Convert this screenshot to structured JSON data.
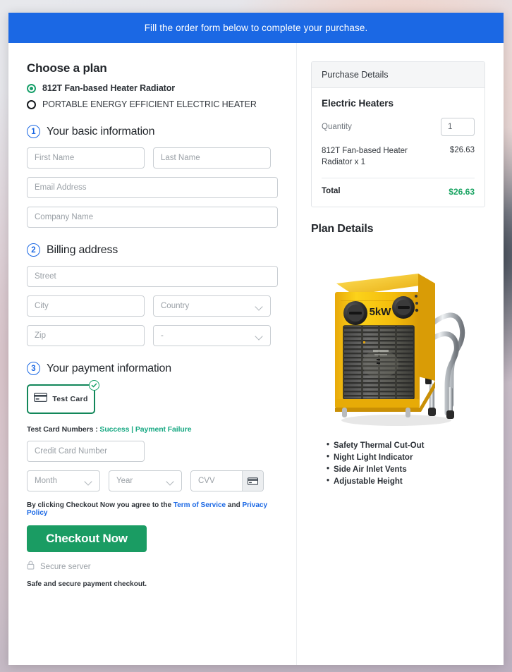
{
  "banner": {
    "text": "Fill the order form below to complete your purchase."
  },
  "plan": {
    "heading": "Choose a plan",
    "options": [
      {
        "label": "812T Fan-based Heater Radiator",
        "selected": true
      },
      {
        "label": "PORTABLE ENERGY EFFICIENT ELECTRIC HEATER",
        "selected": false
      }
    ]
  },
  "steps": [
    {
      "num": "1",
      "title": "Your basic information"
    },
    {
      "num": "2",
      "title": "Billing address"
    },
    {
      "num": "3",
      "title": "Your payment information"
    }
  ],
  "basic_info": {
    "first_name_placeholder": "First Name",
    "last_name_placeholder": "Last Name",
    "email_placeholder": "Email Address",
    "company_placeholder": "Company Name"
  },
  "billing": {
    "street_placeholder": "Street",
    "city_placeholder": "City",
    "country_value": "Country",
    "zip_placeholder": "Zip",
    "state_value": "-"
  },
  "payment": {
    "test_card_label": "Test  Card",
    "card_icon": "credit-card-icon",
    "selected_badge": "check-circle-icon",
    "test_numbers_prefix": "Test Card Numbers :",
    "success_link": "Success",
    "separator": "|",
    "failure_link": "Payment Failure",
    "card_number_placeholder": "Credit Card Number",
    "month_value": "Month",
    "year_value": "Year",
    "cvv_placeholder": "CVV",
    "cvv_icon": "credit-card-icon"
  },
  "footer": {
    "terms_prefix": "By clicking Checkout Now you agree to the",
    "terms_link": "Term of Service",
    "terms_and": "and",
    "privacy_link": "Privacy Policy",
    "checkout_label": "Checkout Now",
    "lock_icon": "lock-icon",
    "secure_server": "Secure server",
    "safe_note": "Safe and secure payment checkout."
  },
  "purchase_details": {
    "header": "Purchase Details",
    "title": "Electric Heaters",
    "quantity_label": "Quantity",
    "quantity_value": "1",
    "line_item": "812T Fan-based Heater Radiator x 1",
    "line_price": "$26.63",
    "total_label": "Total",
    "total_value": "$26.63"
  },
  "plan_details": {
    "heading": "Plan Details",
    "product_image": "electric-fan-heater-image",
    "power_label": "5kW",
    "features": [
      "Safety Thermal Cut-Out",
      "Night Light Indicator",
      "Side Air Inlet Vents",
      "Adjustable Height"
    ]
  },
  "colors": {
    "banner_blue": "#1b68e4",
    "accent_green": "#1a9c63",
    "total_green": "#1aa463",
    "link_teal": "#17a882",
    "link_blue": "#1b68e4",
    "heater_yellow": "#f5c211"
  }
}
